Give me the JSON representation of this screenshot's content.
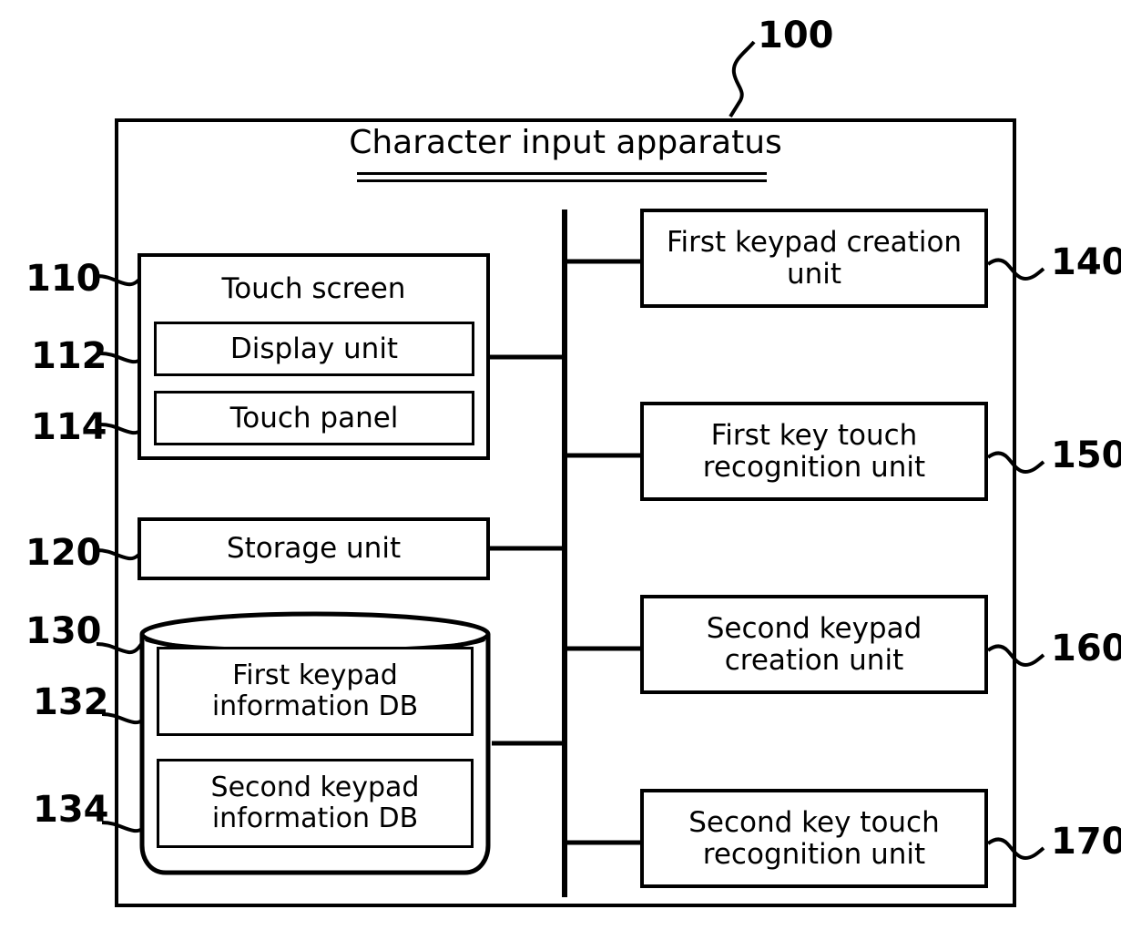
{
  "figure": {
    "title": "Character input apparatus",
    "apparatus_ref": "100"
  },
  "diagram": {
    "type": "block-diagram",
    "frame_label": "Character input apparatus",
    "frame_ref": "100",
    "bus": {
      "orientation": "vertical",
      "description": "central connection bus joining left-side components to right-side units"
    },
    "left_column": [
      {
        "ref": "110",
        "label": "Touch screen",
        "kind": "container-box",
        "children": [
          {
            "ref": "112",
            "label": "Display unit",
            "kind": "box"
          },
          {
            "ref": "114",
            "label": "Touch panel",
            "kind": "box"
          }
        ]
      },
      {
        "ref": "120",
        "label": "Storage unit",
        "kind": "box",
        "children": []
      },
      {
        "ref": "130",
        "label": "",
        "kind": "cylinder-database",
        "children": [
          {
            "ref": "132",
            "label": "First keypad information DB",
            "kind": "box"
          },
          {
            "ref": "134",
            "label": "Second keypad information DB",
            "kind": "box"
          }
        ]
      }
    ],
    "right_column": [
      {
        "ref": "140",
        "label": "First keypad creation unit",
        "kind": "box"
      },
      {
        "ref": "150",
        "label": "First key touch recognition unit",
        "kind": "box"
      },
      {
        "ref": "160",
        "label": "Second keypad creation unit",
        "kind": "box"
      },
      {
        "ref": "170",
        "label": "Second key touch recognition unit",
        "kind": "box"
      }
    ]
  },
  "blocks": {
    "touch_screen": "Touch screen",
    "display_unit": "Display unit",
    "touch_panel": "Touch panel",
    "storage_unit": "Storage unit",
    "first_keypad_db_line1": "First keypad",
    "first_keypad_db_line2": "information DB",
    "second_keypad_db_line1": "Second keypad",
    "second_keypad_db_line2": "information DB",
    "first_keypad_creation_line1": "First keypad creation",
    "first_keypad_creation_line2": "unit",
    "first_key_touch_line1": "First key touch",
    "first_key_touch_line2": "recognition unit",
    "second_keypad_creation_line1": "Second keypad",
    "second_keypad_creation_line2": "creation unit",
    "second_key_touch_line1": "Second key touch",
    "second_key_touch_line2": "recognition unit"
  },
  "refs": {
    "n100": "100",
    "n110": "110",
    "n112": "112",
    "n114": "114",
    "n120": "120",
    "n130": "130",
    "n132": "132",
    "n134": "134",
    "n140": "140",
    "n150": "150",
    "n160": "160",
    "n170": "170"
  },
  "colors": {
    "ink": "#000000",
    "paper": "#ffffff"
  }
}
